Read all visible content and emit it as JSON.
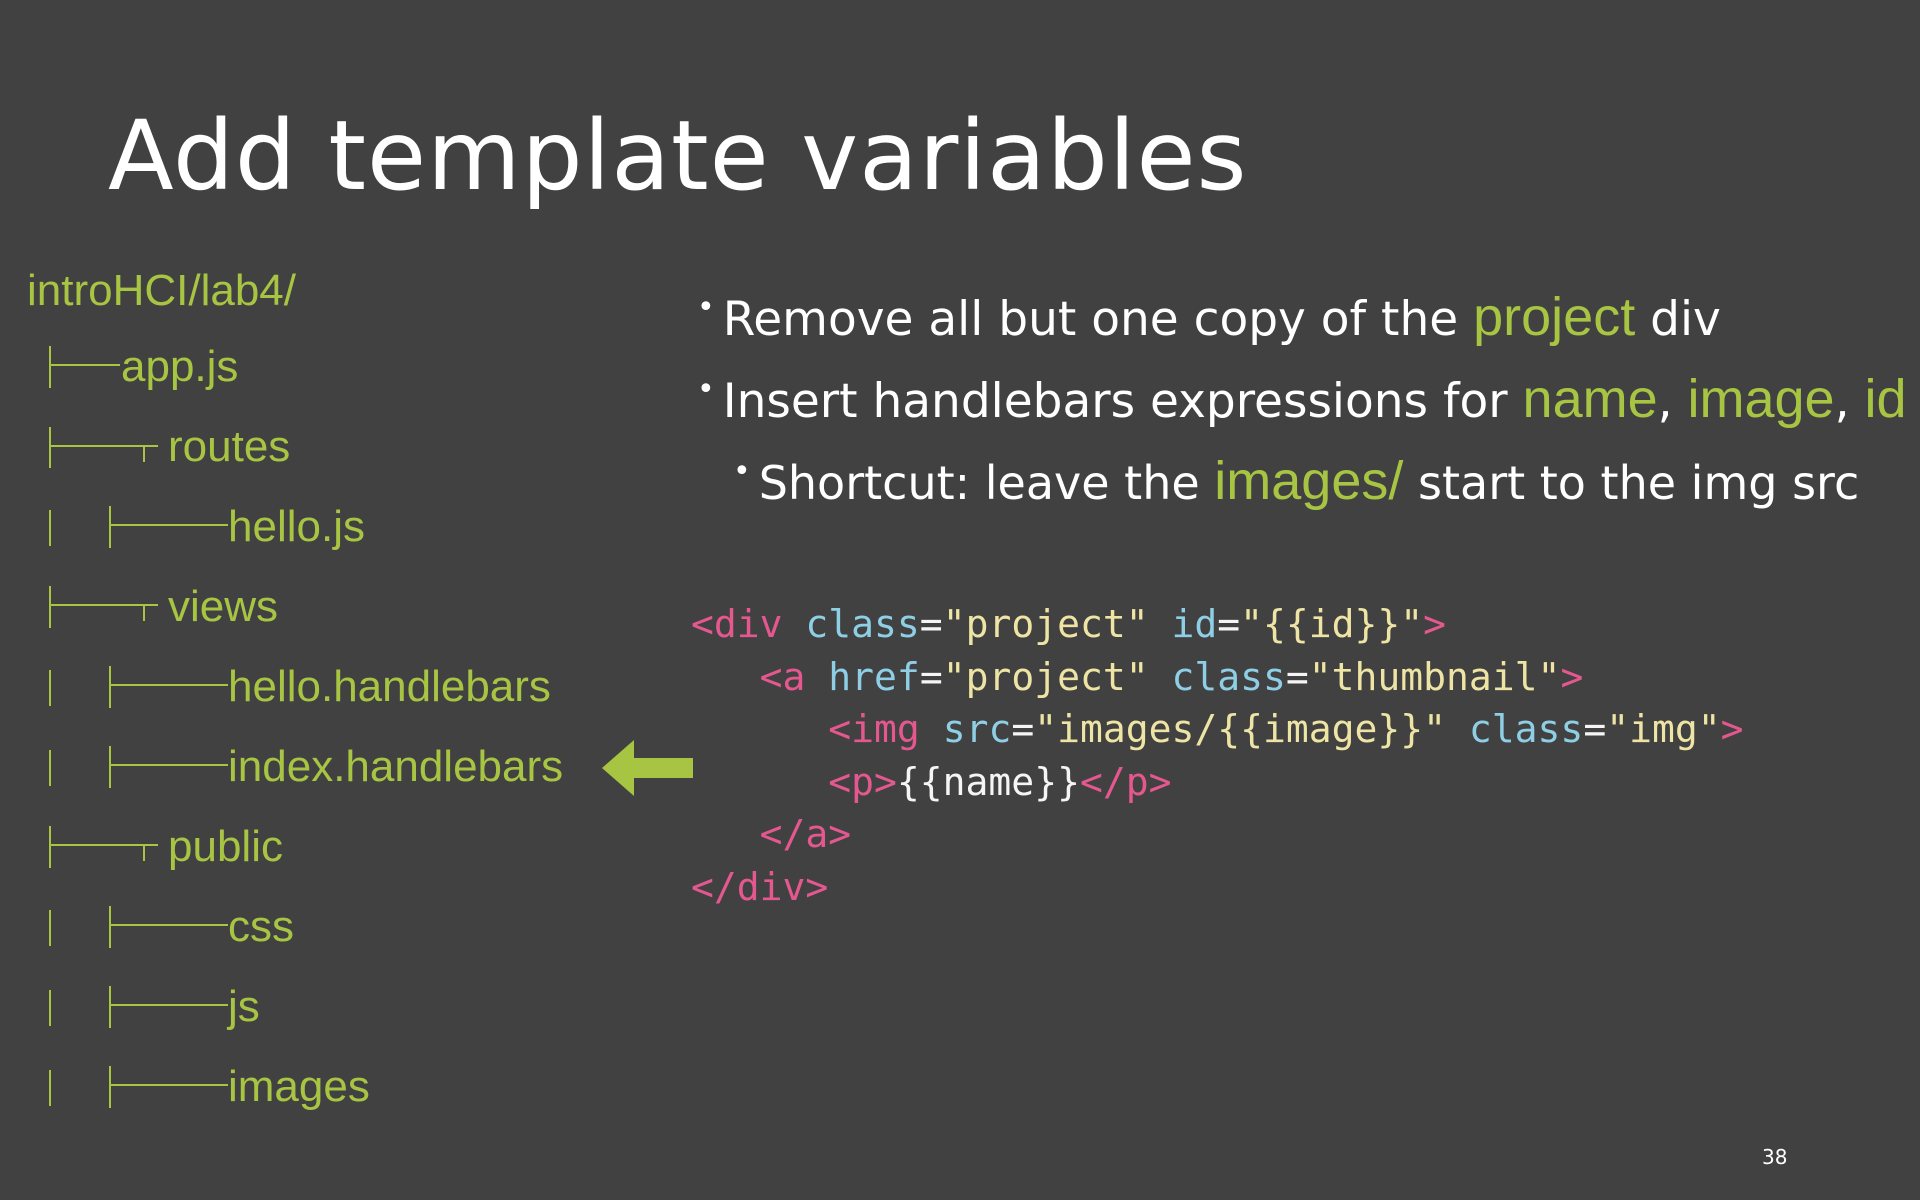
{
  "slide": {
    "title": "Add template variables",
    "page_number": "38"
  },
  "file_tree": {
    "root": "introHCI/lab4/",
    "items": [
      "app.js",
      "routes",
      "hello.js",
      "views",
      "hello.handlebars",
      "index.handlebars",
      "public",
      "css",
      "js",
      "images"
    ]
  },
  "bullets": {
    "b1": {
      "pre": "Remove all but one copy of the ",
      "hl": "project",
      "post": " div"
    },
    "b2": {
      "pre": "Insert handlebars expressions for ",
      "hl1": "name",
      "sep1": ", ",
      "hl2": "image",
      "sep2": ", ",
      "hl3": "id"
    },
    "b3": {
      "pre": "Shortcut: leave the ",
      "hl": "images/",
      "post": " start to the img src"
    }
  },
  "code": {
    "l1": {
      "open": "<div",
      "a1": "class",
      "eq1": "=",
      "v1": "\"project\"",
      "a2": "id",
      "eq2": "=",
      "v2": "\"{{id}}\"",
      "close": ">"
    },
    "l2": {
      "open": "<a",
      "a1": "href",
      "eq1": "=",
      "v1": "\"project\"",
      "a2": "class",
      "eq2": "=",
      "v2": "\"thumbnail\"",
      "close": ">"
    },
    "l3": {
      "open": "<img",
      "a1": "src",
      "eq1": "=",
      "v1": "\"images/{{image}}\"",
      "a2": "class",
      "eq2": "=",
      "v2": "\"img\"",
      "close": ">"
    },
    "l4": {
      "open": "<p>",
      "text": "{{name}}",
      "close": "</p>"
    },
    "l5": {
      "close": "</a>"
    },
    "l6": {
      "close": "</div>"
    }
  },
  "colors": {
    "background": "#414141",
    "accent_green": "#a8c443",
    "tag_pink": "#e4588f",
    "attr_blue": "#8fcfe6",
    "string_yellow": "#eee4a4"
  },
  "icons": {
    "pointer": "left-arrow-icon"
  }
}
